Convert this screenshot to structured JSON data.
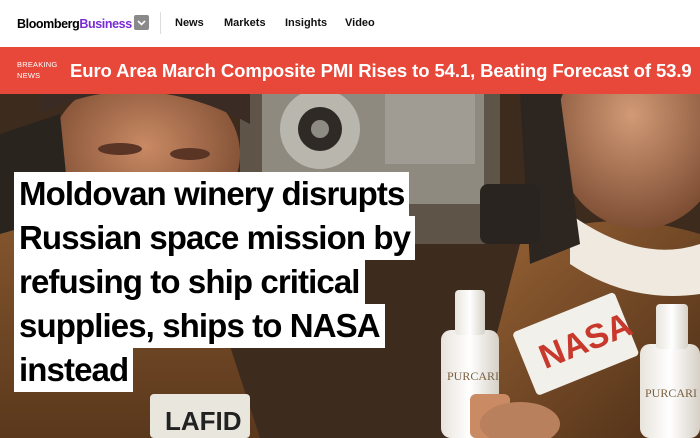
{
  "site": {
    "logo_part1": "Bloomberg",
    "logo_part2": "Business",
    "nav": [
      "News",
      "Markets",
      "Insights",
      "Video"
    ]
  },
  "breaking": {
    "label_line1": "BREAKING",
    "label_line2": "NEWS",
    "headline": "Euro Area March Composite PMI Rises to 54.1, Beating Forecast of 53.9"
  },
  "article": {
    "headline_lines": [
      "Moldovan winery disrupts",
      "Russian space mission by",
      "refusing to ship critical",
      "supplies, ships to NASA",
      "instead"
    ]
  },
  "photo": {
    "bottle_brand": "PURCARI",
    "patch_text": "NASA",
    "suit_text": "LAFID"
  },
  "colors": {
    "breaking_bg": "#e8483a",
    "logo_accent": "#7b2bd6"
  }
}
